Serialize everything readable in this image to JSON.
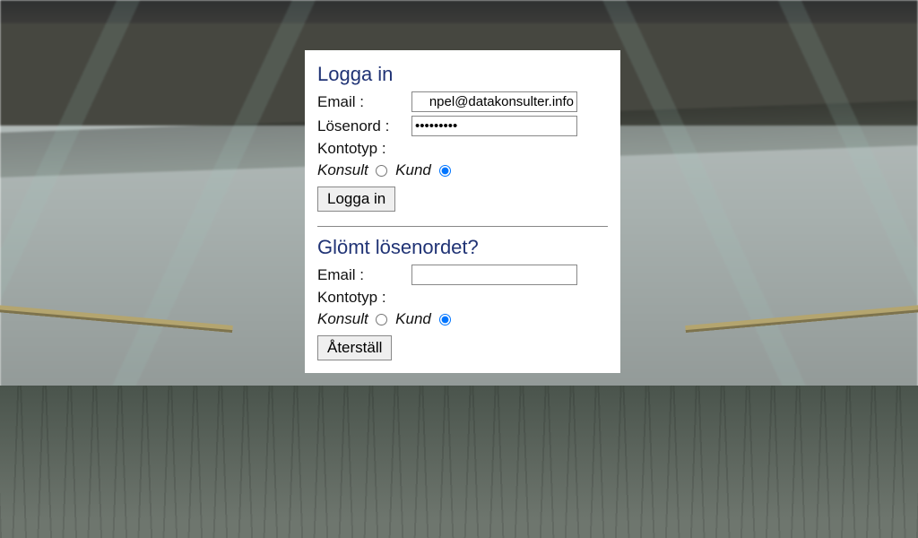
{
  "login": {
    "heading": "Logga in",
    "email_label": "Email :",
    "email_value": "npel@datakonsulter.info",
    "password_label": "Lösenord :",
    "password_value": "•••••••••",
    "account_type_label": "Kontotyp :",
    "option_consultant": "Konsult",
    "option_customer": "Kund",
    "submit": "Logga in"
  },
  "forgot": {
    "heading": "Glömt lösenordet?",
    "email_label": "Email :",
    "email_value": "",
    "account_type_label": "Kontotyp :",
    "option_consultant": "Konsult",
    "option_customer": "Kund",
    "submit": "Återställ"
  }
}
